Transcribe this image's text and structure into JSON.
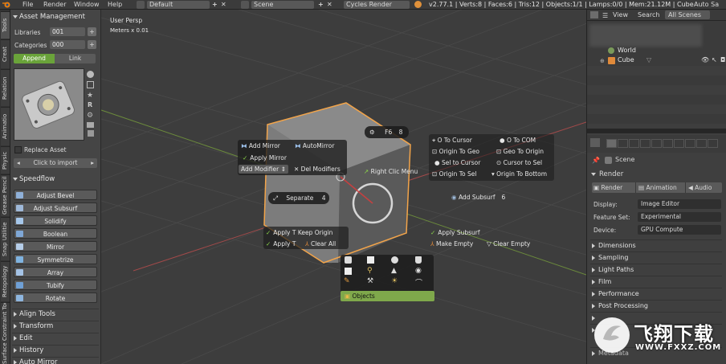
{
  "topbar": {
    "menus": [
      "File",
      "Render",
      "Window",
      "Help"
    ],
    "layout": "Default",
    "scene": "Scene",
    "engine": "Cycles Render",
    "stats": "v2.77.1 | Verts:8 | Faces:6 | Tris:12 | Objects:1/1 | Lamps:0/0 | Mem:21.12M | Cube",
    "auto_save": "Auto Sa"
  },
  "left_tabs": [
    "Tools",
    "Creat",
    "Relation",
    "Animatio",
    "Physic",
    "Grease Pencil",
    "Snap Utilitie",
    "Retopology",
    "Surface Constraint Tool"
  ],
  "asset_management": {
    "title": "Asset Management",
    "libraries_label": "Libraries",
    "libraries_value": "001",
    "categories_label": "Categories",
    "categories_value": "000",
    "append_label": "Append",
    "link_label": "Link",
    "replace_asset": "Replace Asset",
    "click_to_import": "Click to import"
  },
  "speedflow": {
    "title": "Speedflow",
    "buttons": [
      "Adjust Bevel",
      "Adjust Subsurf",
      "Solidify",
      "Boolean",
      "Mirror",
      "Symmetrize",
      "Array",
      "Tubify",
      "Rotate"
    ]
  },
  "bottom_panels": [
    "Align Tools",
    "Transform",
    "Edit",
    "History",
    "Auto Mirror"
  ],
  "viewport": {
    "view_label": "User Persp",
    "scale_label": "Meters x 0.01",
    "pie_menu": {
      "f6": "F6",
      "f6_key": "8",
      "add_mirror": "Add Mirror",
      "auto_mirror": "AutoMirror",
      "apply_mirror": "Apply Mirror",
      "add_modifier": "Add Modifier",
      "del_modifiers": "Del Modifiers",
      "right_clic": "Right Clic Menu",
      "separate": "Separate",
      "separate_key": "4",
      "o_to_cursor": "O To Cursor",
      "o_to_com": "O To COM",
      "origin_to_geo": "Origin To Geo",
      "geo_to_origin": "Geo To Origin",
      "sel_to_cursor": "Sel to Cursor",
      "cursor_to_sel": "Cursor to Sel",
      "origin_to_sel": "Origin To Sel",
      "origin_to_bottom": "Origin To Bottom",
      "add_subsurf": "Add Subsurf",
      "add_subsurf_key": "6",
      "apply_t_keep_origin": "Apply T Keep Origin",
      "apply_t": "Apply T",
      "clear_all": "Clear All",
      "apply_subsurf": "Apply Subsurf",
      "make_empty": "Make Empty",
      "clear_empty": "Clear Empty",
      "objects": "Objects"
    }
  },
  "outliner": {
    "tabs": [
      "View",
      "Search",
      "All Scenes"
    ],
    "items": [
      "World",
      "Cube"
    ]
  },
  "properties": {
    "breadcrumb": "Scene",
    "render_title": "Render",
    "render_buttons": [
      "Render",
      "Animation",
      "Audio"
    ],
    "display_label": "Display:",
    "display_value": "Image Editor",
    "feature_set_label": "Feature Set:",
    "feature_set_value": "Experimental",
    "device_label": "Device:",
    "device_value": "GPU Compute",
    "sections": [
      "Dimensions",
      "Sampling",
      "Light Paths",
      "Film",
      "Performance",
      "Post Processing"
    ],
    "partial_section": "Metadata"
  },
  "watermark": {
    "brand": "飞翔下载",
    "url": "WWW.FXXZ.COM"
  },
  "colors": {
    "accent_green": "#6aa33a",
    "objects_bar": "#7fa84b",
    "engine_orange": "#e0913a"
  }
}
